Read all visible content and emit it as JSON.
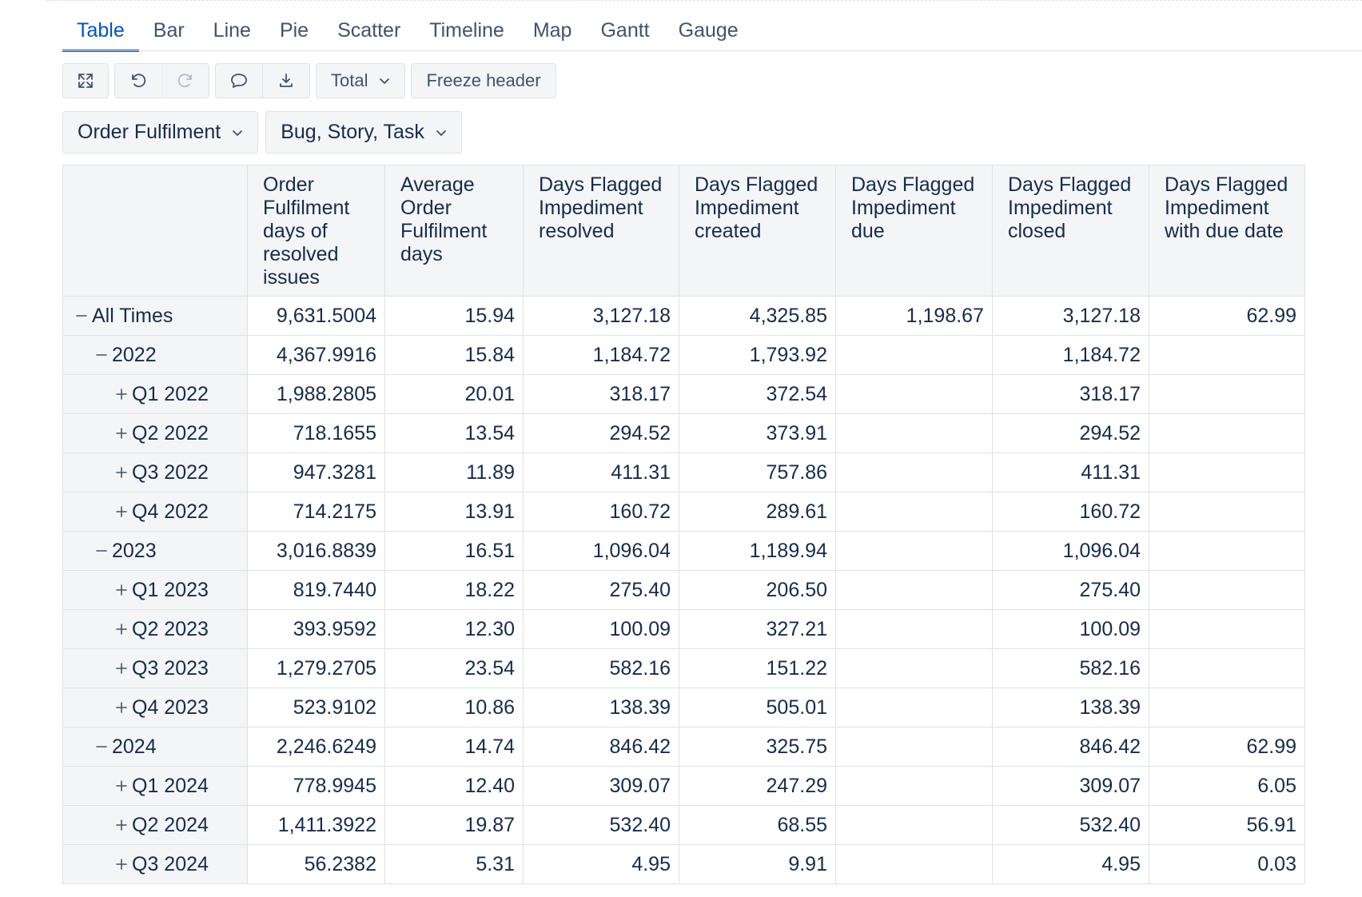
{
  "tabs": [
    "Table",
    "Bar",
    "Line",
    "Pie",
    "Scatter",
    "Timeline",
    "Map",
    "Gantt",
    "Gauge"
  ],
  "active_tab": "Table",
  "toolbar": {
    "icons": [
      "expand-icon",
      "undo-icon",
      "redo-icon",
      "comment-icon",
      "download-icon"
    ],
    "total_label": "Total",
    "freeze_label": "Freeze header"
  },
  "filters": {
    "project": "Order Fulfilment",
    "issue_types": "Bug, Story, Task"
  },
  "table": {
    "headers": [
      "Order Fulfilment days of resolved issues",
      "Average Order Fulfilment days",
      "Days Flagged Impediment resolved",
      "Days Flagged Impediment created",
      "Days Flagged Impediment due",
      "Days Flagged Impediment closed",
      "Days Flagged Impediment with due date"
    ],
    "rows": [
      {
        "label": "All Times",
        "level": 0,
        "toggle": "minus",
        "values": [
          "9,631.5004",
          "15.94",
          "3,127.18",
          "4,325.85",
          "1,198.67",
          "3,127.18",
          "62.99"
        ]
      },
      {
        "label": "2022",
        "level": 1,
        "toggle": "minus",
        "values": [
          "4,367.9916",
          "15.84",
          "1,184.72",
          "1,793.92",
          "",
          "1,184.72",
          ""
        ]
      },
      {
        "label": "Q1 2022",
        "level": 2,
        "toggle": "plus",
        "values": [
          "1,988.2805",
          "20.01",
          "318.17",
          "372.54",
          "",
          "318.17",
          ""
        ]
      },
      {
        "label": "Q2 2022",
        "level": 2,
        "toggle": "plus",
        "values": [
          "718.1655",
          "13.54",
          "294.52",
          "373.91",
          "",
          "294.52",
          ""
        ]
      },
      {
        "label": "Q3 2022",
        "level": 2,
        "toggle": "plus",
        "values": [
          "947.3281",
          "11.89",
          "411.31",
          "757.86",
          "",
          "411.31",
          ""
        ]
      },
      {
        "label": "Q4 2022",
        "level": 2,
        "toggle": "plus",
        "values": [
          "714.2175",
          "13.91",
          "160.72",
          "289.61",
          "",
          "160.72",
          ""
        ]
      },
      {
        "label": "2023",
        "level": 1,
        "toggle": "minus",
        "values": [
          "3,016.8839",
          "16.51",
          "1,096.04",
          "1,189.94",
          "",
          "1,096.04",
          ""
        ]
      },
      {
        "label": "Q1 2023",
        "level": 2,
        "toggle": "plus",
        "values": [
          "819.7440",
          "18.22",
          "275.40",
          "206.50",
          "",
          "275.40",
          ""
        ]
      },
      {
        "label": "Q2 2023",
        "level": 2,
        "toggle": "plus",
        "values": [
          "393.9592",
          "12.30",
          "100.09",
          "327.21",
          "",
          "100.09",
          ""
        ]
      },
      {
        "label": "Q3 2023",
        "level": 2,
        "toggle": "plus",
        "values": [
          "1,279.2705",
          "23.54",
          "582.16",
          "151.22",
          "",
          "582.16",
          ""
        ]
      },
      {
        "label": "Q4 2023",
        "level": 2,
        "toggle": "plus",
        "values": [
          "523.9102",
          "10.86",
          "138.39",
          "505.01",
          "",
          "138.39",
          ""
        ]
      },
      {
        "label": "2024",
        "level": 1,
        "toggle": "minus",
        "values": [
          "2,246.6249",
          "14.74",
          "846.42",
          "325.75",
          "",
          "846.42",
          "62.99"
        ]
      },
      {
        "label": "Q1 2024",
        "level": 2,
        "toggle": "plus",
        "values": [
          "778.9945",
          "12.40",
          "309.07",
          "247.29",
          "",
          "309.07",
          "6.05"
        ]
      },
      {
        "label": "Q2 2024",
        "level": 2,
        "toggle": "plus",
        "values": [
          "1,411.3922",
          "19.87",
          "532.40",
          "68.55",
          "",
          "532.40",
          "56.91"
        ]
      },
      {
        "label": "Q3 2024",
        "level": 2,
        "toggle": "plus",
        "values": [
          "56.2382",
          "5.31",
          "4.95",
          "9.91",
          "",
          "4.95",
          "0.03"
        ]
      }
    ]
  }
}
